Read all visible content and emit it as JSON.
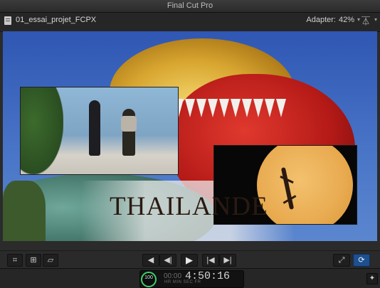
{
  "window": {
    "title": "Final Cut Pro"
  },
  "viewer": {
    "project_name": "01_essai_projet_FCPX",
    "adapter_label": "Adapter:",
    "zoom_value": "42%",
    "overlay_text": "THAILANDE"
  },
  "transport": {
    "prev_edit": "◀",
    "step_back": "◀|",
    "play": "▶",
    "step_forward": "|◀",
    "next_edit": "▶|"
  },
  "timecode": {
    "circle_value": "100",
    "value": "4:50:16",
    "dim_prefix": "00:00",
    "labels": "HR MIN SEC FR"
  },
  "icons": {
    "fullscreen": "fullscreen-icon",
    "loop": "loop-icon",
    "sw": "switch-icon",
    "timecode_ring": "timecode-ring-icon"
  },
  "colors": {
    "accent_blue": "#1e4f8f",
    "ring_green": "#3fd06a"
  }
}
